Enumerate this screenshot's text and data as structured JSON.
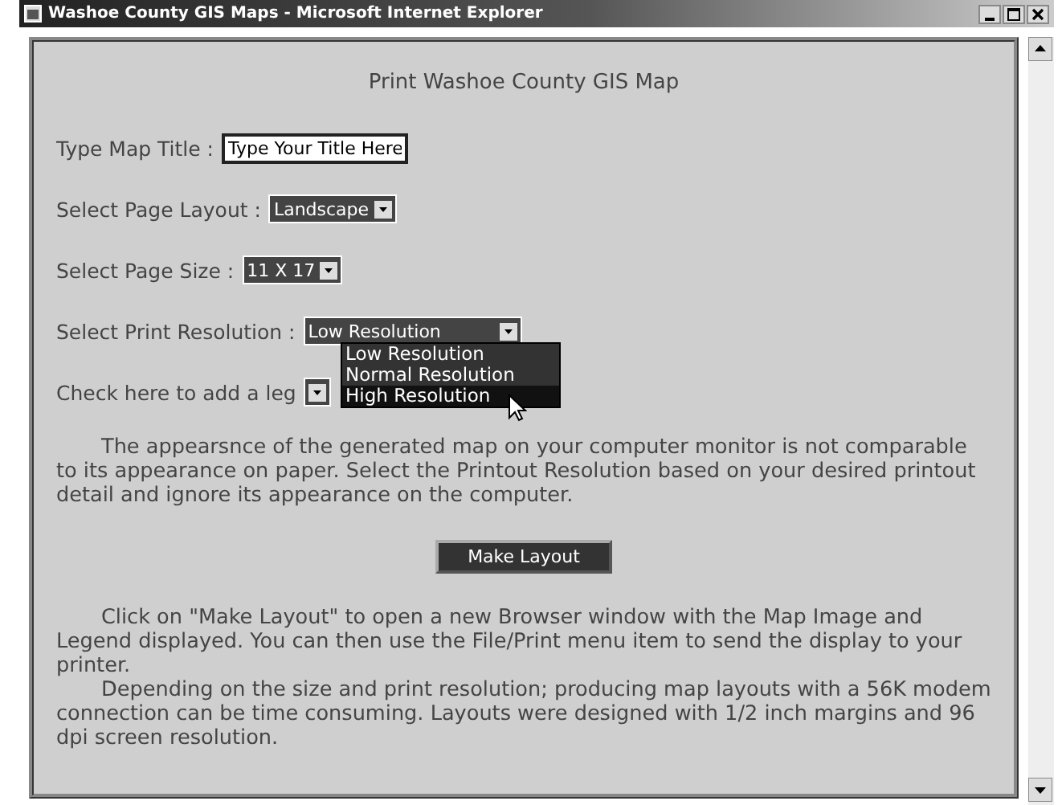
{
  "window": {
    "title": "Washoe County GIS Maps - Microsoft Internet Explorer"
  },
  "heading": "Print Washoe County GIS Map",
  "fields": [
    {
      "kind": "text",
      "label": "Type Map Title :",
      "value": "Type Your Title Here"
    },
    {
      "kind": "select",
      "label": "Select Page Layout :",
      "value": "Landscape"
    },
    {
      "kind": "select",
      "label": "Select Page Size :",
      "value": "11 X 17"
    },
    {
      "kind": "select",
      "label": "Select Print Resolution :",
      "value": "Low Resolution",
      "open": true,
      "options": [
        {
          "label": "Low Resolution",
          "highlighted": false
        },
        {
          "label": "Normal Resolution",
          "highlighted": false
        },
        {
          "label": "High Resolution",
          "highlighted": true
        }
      ]
    },
    {
      "kind": "select",
      "label": "Check here to add a leg"
    }
  ],
  "note": "The appearsnce of the generated map on your computer monitor is not comparable to its appearance on paper. Select the Printout Resolution based on your desired printout detail and ignore its appearance on the computer.",
  "button": "Make Layout",
  "paragraphs": [
    "Click on \"Make Layout\" to open a new Browser window with the Map Image and Legend displayed. You can then use the File/Print menu item to send the display to your printer.",
    "Depending on the size and print resolution; producing map layouts with a 56K modem connection can be time consuming. Layouts were designed with 1/2 inch margins and 96 dpi screen resolution."
  ]
}
